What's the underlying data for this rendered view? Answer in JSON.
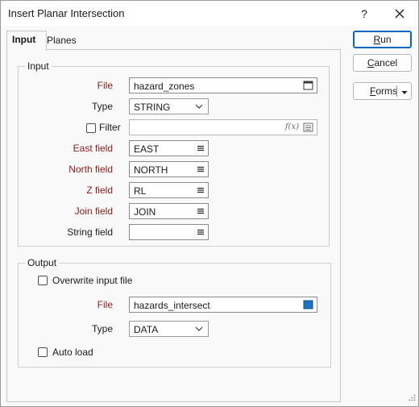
{
  "window": {
    "title": "Insert Planar Intersection",
    "help_label": "?"
  },
  "tabs": [
    {
      "label": "Input"
    },
    {
      "label": "Planes"
    }
  ],
  "input_group": {
    "title": "Input",
    "file": {
      "label": "File",
      "value": "hazard_zones"
    },
    "type": {
      "label": "Type",
      "value": "STRING"
    },
    "filter": {
      "label": "Filter",
      "value": "",
      "fx_label": "f(x)"
    },
    "east": {
      "label": "East field",
      "value": "EAST"
    },
    "north": {
      "label": "North field",
      "value": "NORTH"
    },
    "z": {
      "label": "Z field",
      "value": "RL"
    },
    "join": {
      "label": "Join field",
      "value": "JOIN"
    },
    "string": {
      "label": "String field",
      "value": ""
    }
  },
  "output_group": {
    "title": "Output",
    "overwrite_label": "Overwrite input file",
    "file": {
      "label": "File",
      "value": "hazards_intersect"
    },
    "type": {
      "label": "Type",
      "value": "DATA"
    },
    "auto_load_label": "Auto load"
  },
  "buttons": {
    "run": {
      "first": "R",
      "rest": "un"
    },
    "cancel": {
      "first": "C",
      "rest": "ancel"
    },
    "forms": {
      "first": "F",
      "rest": "orms"
    }
  },
  "colors": {
    "required_label": "#8b1a1a",
    "accent": "#0067c0",
    "output_swatch": "#1e73be"
  }
}
